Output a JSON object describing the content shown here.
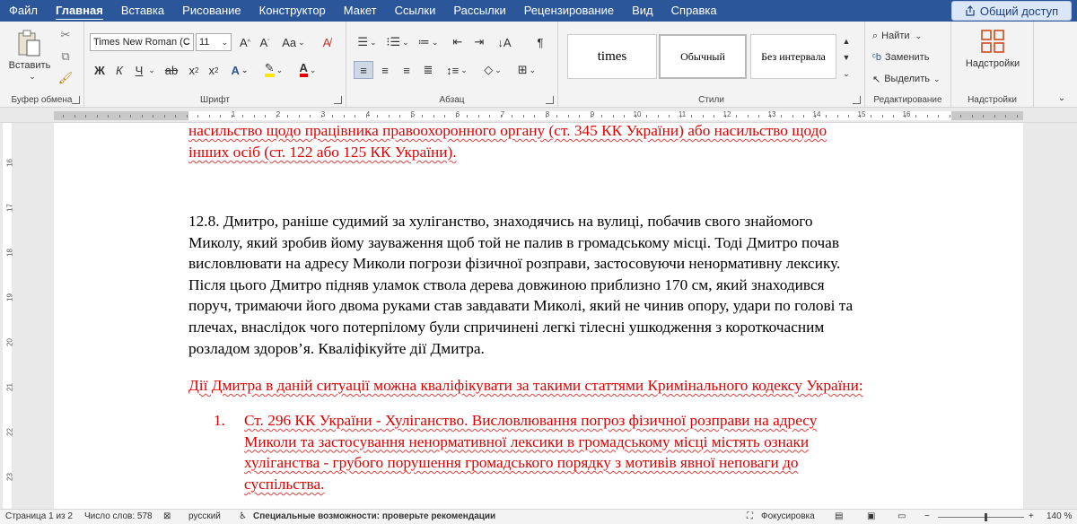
{
  "menu": {
    "tabs": [
      "Файл",
      "Главная",
      "Вставка",
      "Рисование",
      "Конструктор",
      "Макет",
      "Ссылки",
      "Рассылки",
      "Рецензирование",
      "Вид",
      "Справка"
    ],
    "active_index": 1,
    "share_label": "Общий доступ"
  },
  "ribbon": {
    "clipboard": {
      "paste_label": "Вставить",
      "group_label": "Буфер обмена"
    },
    "font": {
      "font_name": "Times New Roman (С",
      "font_size": "11",
      "group_label": "Шрифт",
      "bold": "Ж",
      "italic": "К",
      "underline": "Ч",
      "strike": "ab",
      "case": "Aa"
    },
    "paragraph": {
      "group_label": "Абзац"
    },
    "styles": {
      "items": [
        "times",
        "Обычный",
        "Без интервала"
      ],
      "group_label": "Стили"
    },
    "editing": {
      "find_label": "Найти",
      "replace_label": "Заменить",
      "select_label": "Выделить",
      "group_label": "Редактирование"
    },
    "addins": {
      "button_label": "Надстройки",
      "group_label": "Надстройки"
    }
  },
  "ruler": {
    "numbers": [
      "1",
      "2",
      "3",
      "4",
      "5",
      "6",
      "7",
      "8",
      "9",
      "10",
      "11",
      "12",
      "13",
      "14",
      "15",
      "16"
    ]
  },
  "vruler": {
    "numbers": [
      "16",
      "17",
      "18",
      "19",
      "20",
      "21",
      "22",
      "23"
    ]
  },
  "document": {
    "top_red_line1": "насильство щодо працівника правоохоронного органу (ст. 345 КК України) або насильство щодо",
    "top_red_line2": "інших осіб (ст. 122 або 125 КК України).",
    "task_lines": [
      "12.8. Дмитро, раніше судимий за хуліганство, знаходячись на вулиці, побачив свого знайомого",
      "Миколу, який зробив йому зауваження щоб той не палив в громадському місці. Тоді Дмитро почав",
      "висловлювати на адресу Миколи погрози фізичної розправи, застосовуючи ненормативну лексику.",
      "Після цього Дмитро підняв уламок ствола дерева довжиною приблизно 170 см, який знаходився",
      "поруч, тримаючи його двома руками став завдавати Миколі, який не чинив опору, удари по голові та",
      "плечах, внаслідок чого потерпілому були спричинені легкі тілесні ушкодження з короткочасним",
      "розладом здоров’я. Кваліфікуйте дії Дмитра."
    ],
    "answer_intro": "Дії Дмитра в даній ситуації можна кваліфікувати за такими статтями Кримінального кодексу України:",
    "list_number": "1.",
    "list_lines": [
      "Ст. 296 КК України - Хуліганство. Висловлювання погроз фізичної розправи на адресу",
      "Миколи та застосування ненормативної лексики в громадському місці містять ознаки",
      "хуліганства - грубого порушення громадського порядку з мотивів явної неповаги до",
      "суспільства."
    ]
  },
  "status": {
    "page": "Страница 1 из 2",
    "words": "Число слов: 578",
    "language": "русский",
    "accessibility": "Специальные возможности: проверьте рекомендации",
    "focus": "Фокусировка",
    "zoom": "140 %"
  },
  "colors": {
    "menu_bg": "#2b579a",
    "red_text": "#e00000"
  }
}
